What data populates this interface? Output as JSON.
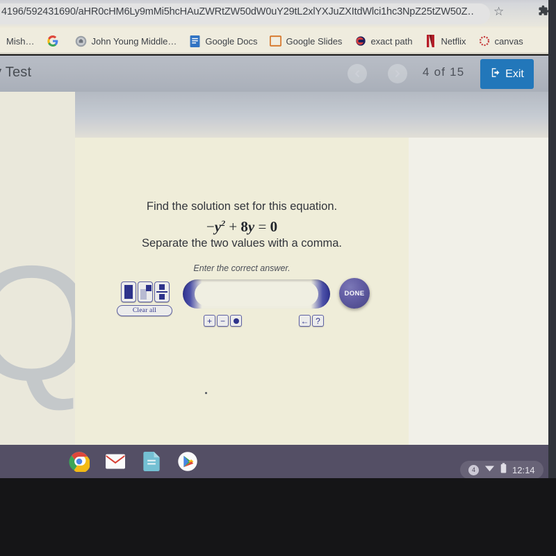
{
  "browser": {
    "url": "4196/592431690/aHR0cHM6Ly9mMi5hcHAuZWRtZW50dW0uY29tL2xlYXJuZXItdWkvc3NpL1hc3NpZ25tZW50Z...",
    "url_visible": "4196/592431690/aHR0cHM6Ly9mMi5hcHAuZWRtZW50dW0uY29tL2xlYXJuZXItdWlci1hc3NpZ25tZW50Z…",
    "star_icon": "star-icon",
    "extensions_icon": "puzzle-icon",
    "bookmarks": [
      {
        "label": "Mish…",
        "icon": "generic-bookmark-icon"
      },
      {
        "label": "",
        "icon": "google-icon"
      },
      {
        "label": "John Young Middle…",
        "icon": "school-crest-icon"
      },
      {
        "label": "Google Docs",
        "icon": "google-docs-icon"
      },
      {
        "label": "Google Slides",
        "icon": "google-slides-icon"
      },
      {
        "label": "exact path",
        "icon": "exact-path-icon"
      },
      {
        "label": "Netflix",
        "icon": "netflix-icon"
      },
      {
        "label": "canvas",
        "icon": "canvas-icon"
      }
    ]
  },
  "app_header": {
    "title": "ery Test",
    "prev_icon": "chevron-left-icon",
    "next_icon": "chevron-right-icon",
    "page_count": "4  of  15",
    "exit_label": "Exit",
    "exit_icon": "exit-door-icon",
    "exit_color": "#1a78c2"
  },
  "question": {
    "prompt": "Find the solution set for this equation.",
    "equation": {
      "minus": "−",
      "var": "y",
      "exponent": "2",
      "plus": "+",
      "coefficient": "8",
      "var2": "y",
      "equals": "=",
      "rhs": "0",
      "plain": "−y² + 8y = 0"
    },
    "instruction": "Separate the two values with a comma.",
    "hint": "Enter the correct answer."
  },
  "math_toolbar": {
    "templates": [
      {
        "name": "empty-box-template",
        "label": ""
      },
      {
        "name": "superscript-template",
        "label": ""
      },
      {
        "name": "fraction-template",
        "label": ""
      }
    ],
    "clear_all_label": "Clear all",
    "answer_value": "",
    "answer_placeholder": "",
    "operators": [
      {
        "name": "plus-button",
        "glyph": "+"
      },
      {
        "name": "minus-button",
        "glyph": "−"
      },
      {
        "name": "dot-button",
        "glyph": "●"
      }
    ],
    "right_buttons": [
      {
        "name": "backspace-button",
        "glyph": "←"
      },
      {
        "name": "help-button",
        "glyph": "?"
      }
    ],
    "done_label": "DONE",
    "accent_color": "#2b3092",
    "done_color": "#5f5aa8"
  },
  "watermark": {
    "letter": "Q"
  },
  "shelf": {
    "apps": [
      {
        "name": "chrome-icon"
      },
      {
        "name": "gmail-icon"
      },
      {
        "name": "google-docs-app-icon"
      },
      {
        "name": "play-store-icon"
      }
    ],
    "tray": {
      "notification_count": "4",
      "wifi_icon": "wifi-icon",
      "battery_icon": "battery-icon",
      "time": "12:14"
    }
  }
}
